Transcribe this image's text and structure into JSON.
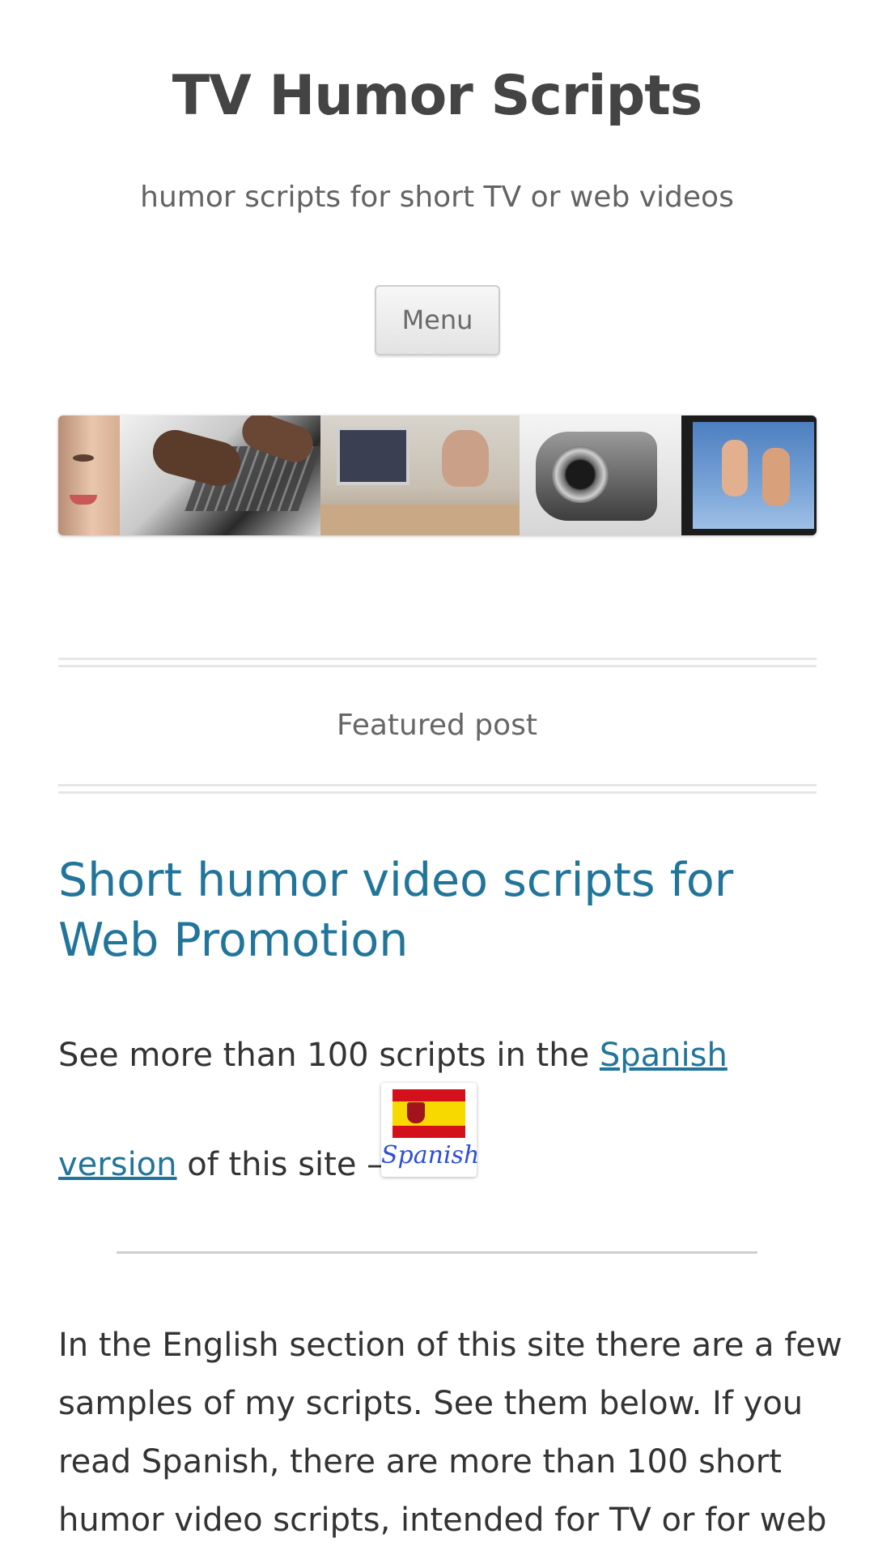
{
  "header": {
    "site_title": "TV Humor Scripts",
    "tagline": "humor scripts for short TV or web videos",
    "menu_label": "Menu"
  },
  "featured": {
    "label": "Featured post"
  },
  "post": {
    "title": "Short humor video scripts for Web Promotion",
    "intro_text_before_link": "See more than 100 scripts in the ",
    "spanish_link_part1": "Spanish",
    "spanish_link_part2": "version",
    "intro_text_after_link": " of this site – ",
    "flag_badge_text": "Spanish",
    "body_lines": [
      "In the English section of this site there are a few",
      "samples of my scripts. See them below. If you",
      "read Spanish, there are more than 100 short",
      "humor video scripts, intended for TV or for web"
    ]
  },
  "colors": {
    "link": "#21759b",
    "title_text": "#444444",
    "body_text": "#333333"
  },
  "icons": {
    "flag": "spain-flag-icon"
  }
}
